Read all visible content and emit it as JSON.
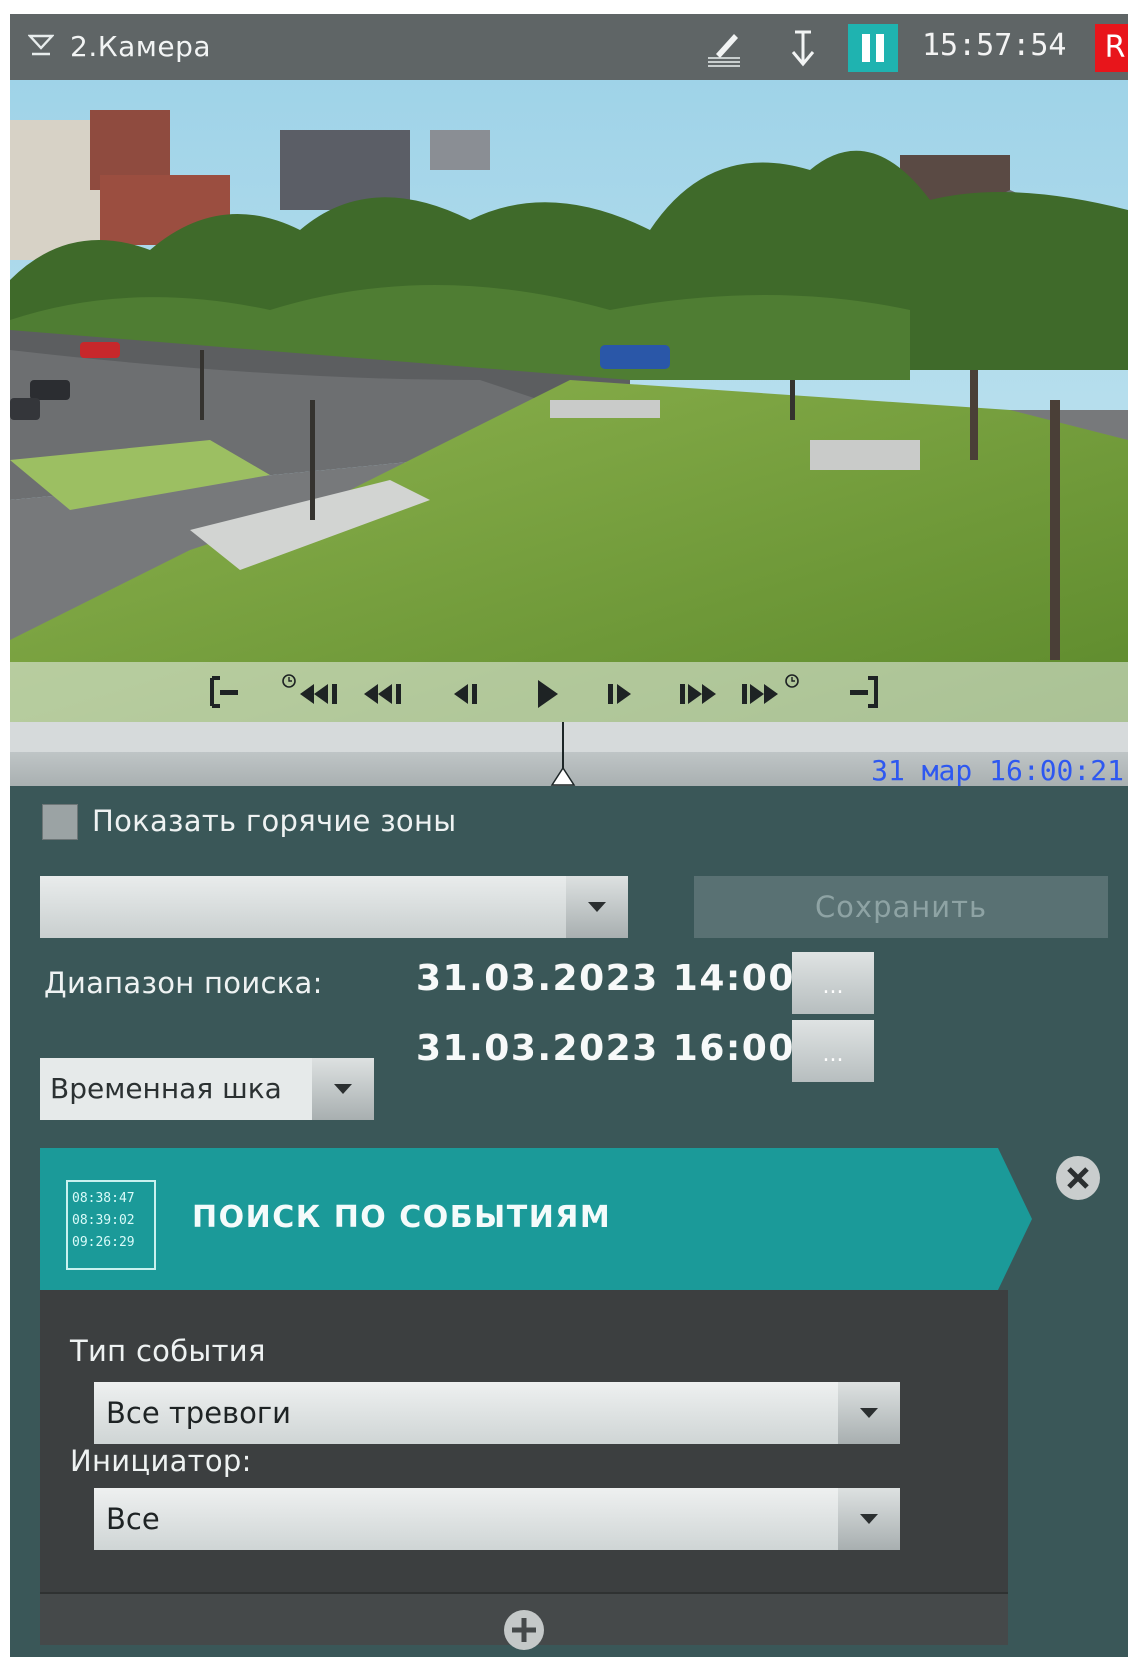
{
  "titlebar": {
    "camera_name": "2.Камера",
    "time": "15:57:54",
    "rec_label": "R",
    "icons": [
      "filter-icon",
      "edit-icon",
      "arrow-down-icon",
      "pause-icon"
    ]
  },
  "player": {
    "controls": [
      "go-start-icon",
      "prev-event-icon",
      "prev-fast-icon",
      "prev-frame-icon",
      "play-icon",
      "next-frame-icon",
      "next-fast-icon",
      "next-event-icon",
      "go-end-icon"
    ]
  },
  "timeline": {
    "timestamp": "31 мар 16:00:21"
  },
  "panel": {
    "show_hot_zones_label": "Показать горячие зоны",
    "preset_value": "",
    "save_label": "Сохранить",
    "search_range_label": "Диапазон поиска:",
    "range_from": "31.03.2023 14:00",
    "range_to": "31.03.2023 16:00",
    "ellipsis_label": "...",
    "range_mode_value": "Временная шка"
  },
  "event_search": {
    "title": "ПОИСК ПО СОБЫТИЯМ",
    "icon_times": [
      "08:38:47",
      "08:39:02",
      "09:26:29"
    ],
    "event_type_label": "Тип события",
    "event_type_value": "Все тревоги",
    "initiator_label": "Инициатор:",
    "initiator_value": "Все"
  },
  "colors": {
    "accent": "#1fb3b0",
    "panel_bg": "#3a5758",
    "card_head": "#1b9a99",
    "timestamp": "#2e58f0",
    "rec": "#e8151b"
  }
}
